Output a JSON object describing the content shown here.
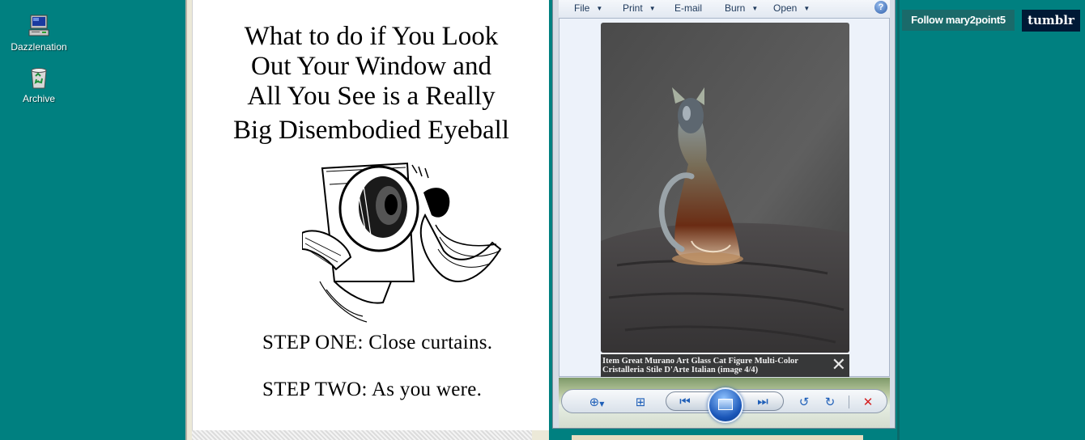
{
  "desktop": {
    "icons": [
      {
        "label": "Dazzlenation",
        "icon": "computer-icon"
      },
      {
        "label": "Archive",
        "icon": "recycle-bin-icon"
      }
    ]
  },
  "paper": {
    "headline": [
      "What to do if You Look",
      "Out Your Window and",
      "All You See is a Really",
      "Big Disembodied Eyeball"
    ],
    "step_one": "STEP ONE: Close curtains.",
    "step_two": "STEP TWO: As you were."
  },
  "viewer": {
    "menu": [
      "File",
      "Print",
      "E-mail",
      "Burn",
      "Open"
    ],
    "help": "?",
    "caption": "Item Great Murano Art Glass Cat Figure Multi-Color Cristalleria Stile D'Arte Italian (image 4/4)",
    "colors": {
      "menu_text": "#1e395b",
      "accent": "#1f5fb8",
      "delete": "#d42020"
    }
  },
  "tumblr": {
    "follow_label": "Follow mary2point5",
    "logo": "tumblr"
  }
}
